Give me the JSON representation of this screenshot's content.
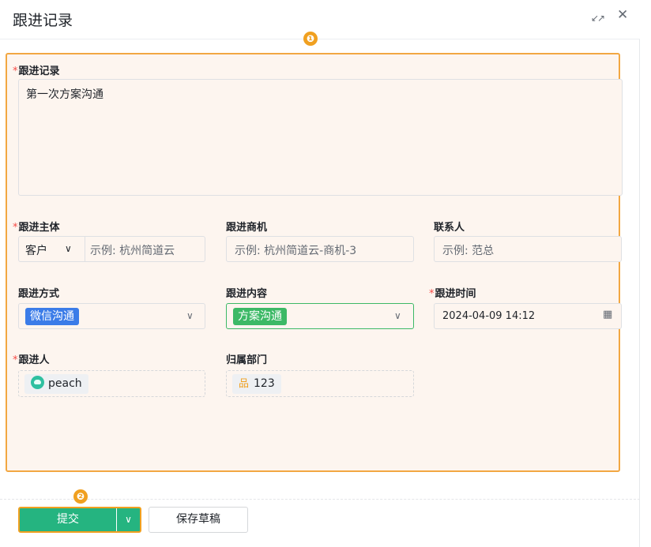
{
  "dialog": {
    "title": "跟进记录",
    "expand_icon": "expand-icon",
    "close_icon": "close-icon"
  },
  "markers": [
    "❶",
    "❷"
  ],
  "form": {
    "required_mark": "*",
    "record": {
      "label": "跟进记录",
      "value": "第一次方案沟通"
    },
    "subject": {
      "label": "跟进主体",
      "type_value": "客户",
      "placeholder": "示例: 杭州简道云"
    },
    "opportunity": {
      "label": "跟进商机",
      "placeholder": "示例: 杭州简道云-商机-3"
    },
    "contact": {
      "label": "联系人",
      "placeholder": "示例: 范总"
    },
    "method": {
      "label": "跟进方式",
      "value": "微信沟通",
      "tag_color": "#3b7ce8"
    },
    "content": {
      "label": "跟进内容",
      "value": "方案沟通",
      "tag_color": "#3cb966"
    },
    "time": {
      "label": "跟进时间",
      "value": "2024-04-09 14:12"
    },
    "follower": {
      "label": "跟进人",
      "value": "peach"
    },
    "department": {
      "label": "归属部门",
      "value": "123"
    }
  },
  "footer": {
    "submit_label": "提交",
    "draft_label": "保存草稿"
  },
  "colors": {
    "accent_green": "#25b480",
    "highlight_orange": "#f2a742",
    "form_bg": "#fdf5ef"
  }
}
